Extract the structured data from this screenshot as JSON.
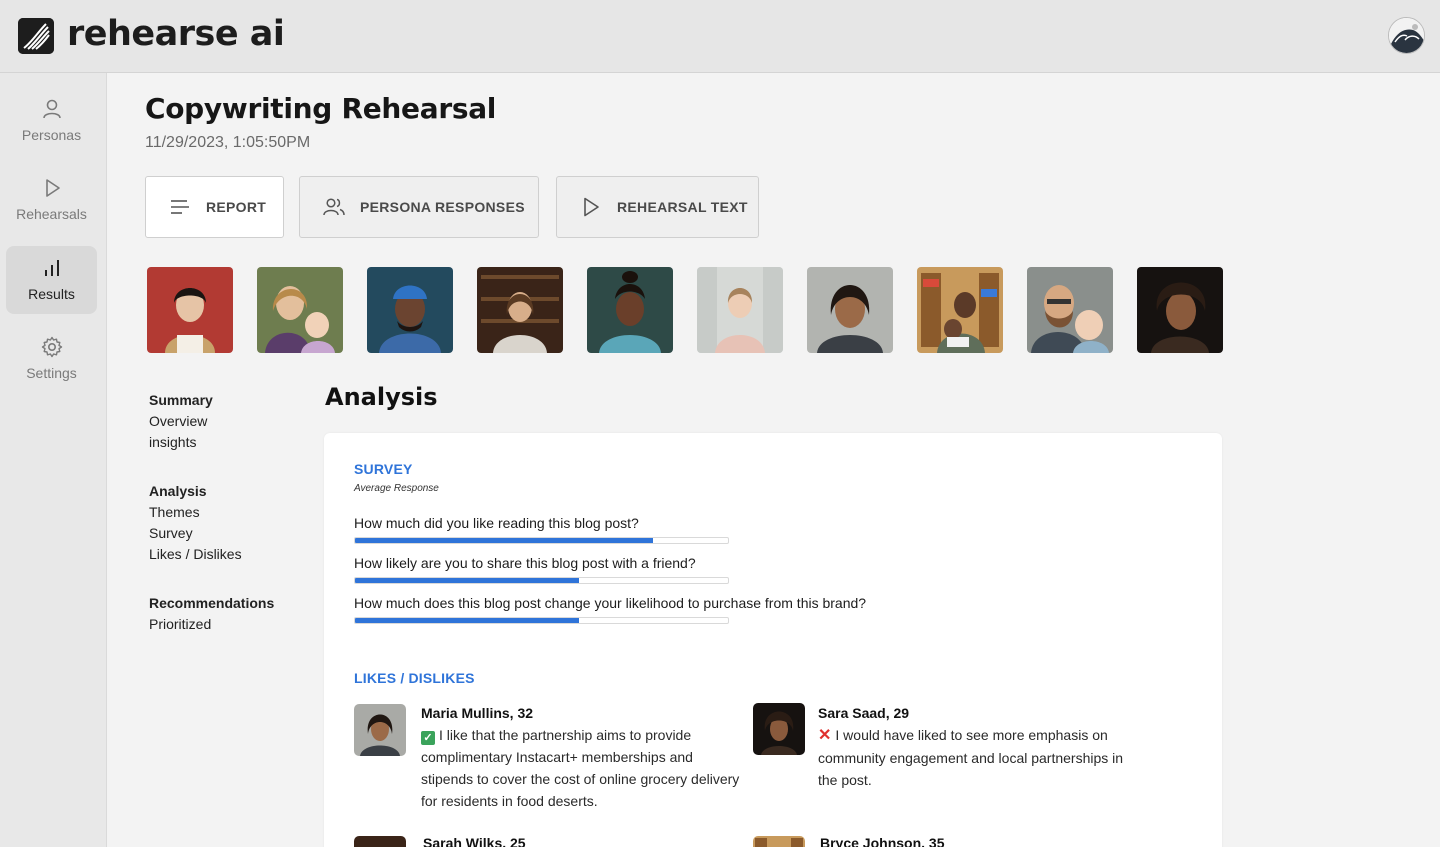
{
  "app": {
    "name": "rehearse ai"
  },
  "sidebar": {
    "items": [
      {
        "label": "Personas",
        "icon": "user-icon",
        "active": false
      },
      {
        "label": "Rehearsals",
        "icon": "play-icon",
        "active": false
      },
      {
        "label": "Results",
        "icon": "bar-chart-icon",
        "active": true
      },
      {
        "label": "Settings",
        "icon": "gear-icon",
        "active": false
      }
    ]
  },
  "header": {
    "title": "Copywriting Rehearsal",
    "date": "11/29/2023, 1:05:50PM"
  },
  "tabs": [
    {
      "label": "REPORT",
      "icon": "lines-icon"
    },
    {
      "label": "PERSONA RESPONSES",
      "icon": "users-icon"
    },
    {
      "label": "REHEARSAL TEXT",
      "icon": "play-outline-icon"
    }
  ],
  "outline": [
    {
      "heading": "Summary",
      "items": [
        "Overview",
        "insights"
      ]
    },
    {
      "heading": "Analysis",
      "items": [
        "Themes",
        "Survey",
        "Likes / Dislikes"
      ]
    },
    {
      "heading": "Recommendations",
      "items": [
        "Prioritized"
      ]
    }
  ],
  "analysis": {
    "title": "Analysis",
    "survey": {
      "label": "SURVEY",
      "sublabel": "Average Response",
      "questions": [
        {
          "text": "How much did you like reading this blog post?",
          "value": 0.8
        },
        {
          "text": "How likely are you to share this blog post with a friend?",
          "value": 0.6
        },
        {
          "text": "How much does this blog post change your likelihood to purchase from this brand?",
          "value": 0.6
        }
      ]
    },
    "likes": {
      "label": "LIKES / DISLIKES",
      "entries": [
        {
          "name": "Maria Mullins, 32",
          "sentiment": "like",
          "mark": "✓",
          "text": "I like that the partnership aims to provide complimentary Instacart+ memberships and stipends to cover the cost of online grocery delivery for residents in food deserts."
        },
        {
          "name": "Sara Saad, 29",
          "sentiment": "dislike",
          "mark": "✕",
          "text": "I would have liked to see more emphasis on community engagement and local partnerships in the post."
        },
        {
          "name": "Sarah Wilks, 25"
        },
        {
          "name": "Bryce Johnson, 35"
        }
      ]
    }
  },
  "colors": {
    "accent": "#2f74d9",
    "like": "#3aa35b",
    "dislike": "#e0302e"
  }
}
